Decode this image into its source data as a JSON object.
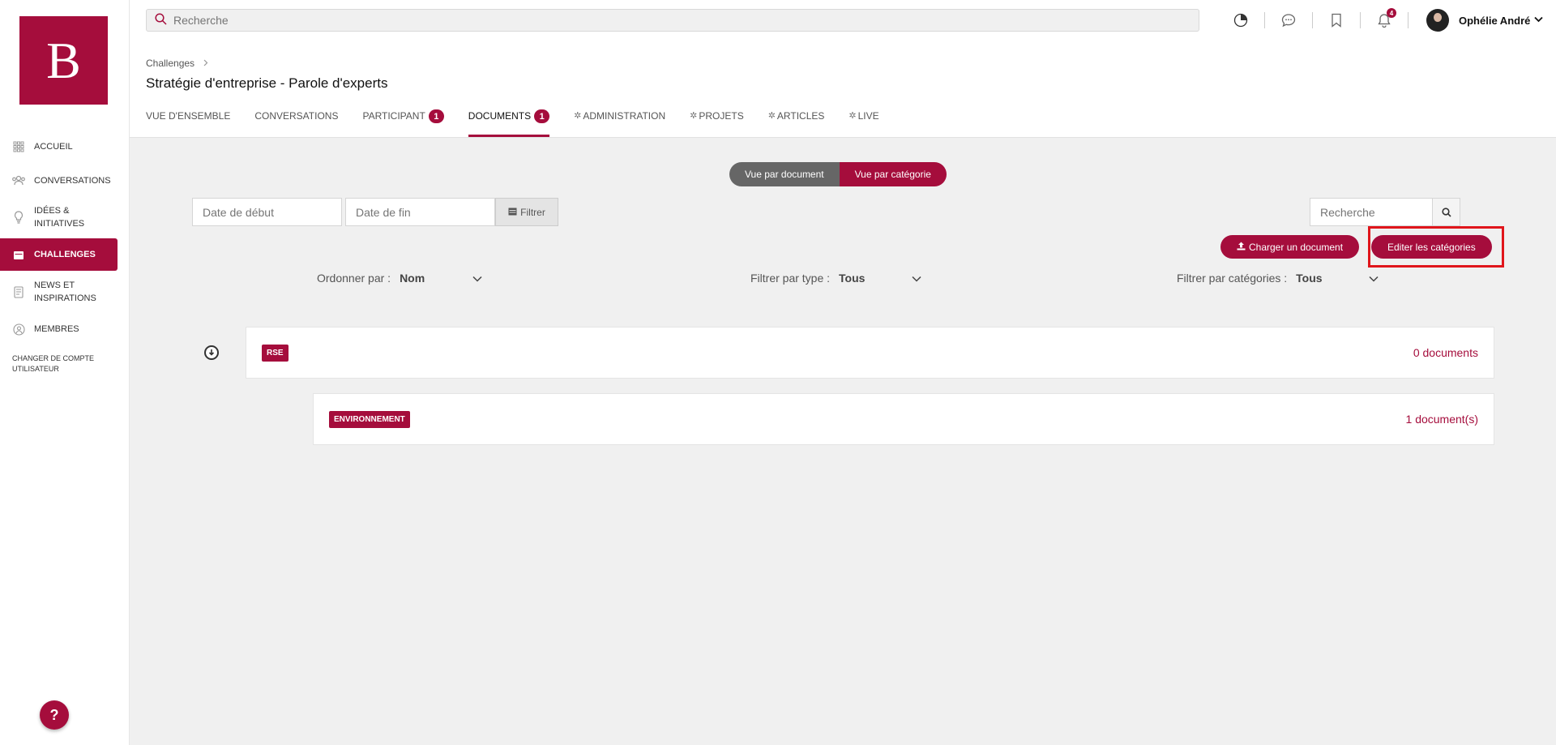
{
  "topbar": {
    "search_placeholder": "Recherche",
    "notifications_count": "4",
    "user_name": "Ophélie André"
  },
  "sidebar": {
    "logo_letter": "B",
    "items": [
      {
        "label": "ACCUEIL",
        "icon": "grid-icon"
      },
      {
        "label": "CONVERSATIONS",
        "icon": "people-icon"
      },
      {
        "label": "IDÉES & INITIATIVES",
        "icon": "lightbulb-icon"
      },
      {
        "label": "CHALLENGES",
        "icon": "calendar-icon"
      },
      {
        "label": "NEWS ET INSPIRATIONS",
        "icon": "document-icon"
      },
      {
        "label": "MEMBRES",
        "icon": "member-icon"
      }
    ],
    "switch_account": "CHANGER DE COMPTE UTILISATEUR",
    "help": "?"
  },
  "header": {
    "breadcrumb": "Challenges",
    "title": "Stratégie d'entreprise - Parole d'experts",
    "tabs": [
      {
        "label": "VUE D'ENSEMBLE"
      },
      {
        "label": "CONVERSATIONS"
      },
      {
        "label": "PARTICIPANT",
        "count": "1"
      },
      {
        "label": "DOCUMENTS",
        "count": "1"
      },
      {
        "label": "ADMINISTRATION"
      },
      {
        "label": "PROJETS"
      },
      {
        "label": "ARTICLES"
      },
      {
        "label": "LIVE"
      }
    ]
  },
  "main": {
    "view_by_document": "Vue par document",
    "view_by_category": "Vue par catégorie",
    "start_date_placeholder": "Date de début",
    "end_date_placeholder": "Date de fin",
    "filter_label": "Filtrer",
    "search_placeholder": "Recherche",
    "upload_label": "Charger un document",
    "edit_categories_label": "Editer les catégories",
    "order_by_label": "Ordonner par :",
    "order_by_value": "Nom",
    "filter_type_label": "Filtrer par type :",
    "filter_type_value": "Tous",
    "filter_category_label": "Filtrer par catégories :",
    "filter_category_value": "Tous",
    "categories": [
      {
        "tag": "RSE",
        "count": "0 documents"
      },
      {
        "tag": "ENVIRONNEMENT",
        "count": "1 document(s)"
      }
    ]
  },
  "colors": {
    "brand": "#a50d3c",
    "highlight": "#e0151b"
  }
}
